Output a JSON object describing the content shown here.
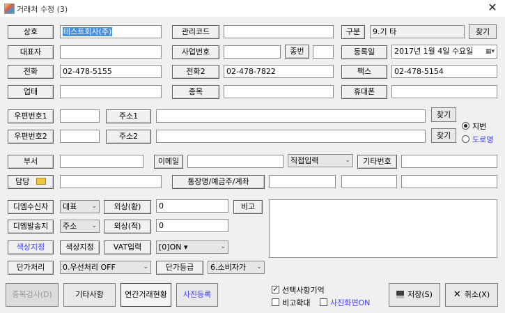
{
  "window": {
    "title": "거래처 수정 (3)",
    "close": "✕"
  },
  "fields": {
    "sangho": {
      "label": "상호",
      "value": "테스트회사(주)"
    },
    "gwanri": {
      "label": "관리코드",
      "value": ""
    },
    "gubun": {
      "label": "구분",
      "value": "9.기   타",
      "button": "찾기"
    },
    "daepyo": {
      "label": "대표자",
      "value": ""
    },
    "saup": {
      "label": "사업번호",
      "value": "",
      "jongbeon_label": "종번",
      "jongbeon_value": ""
    },
    "deungrok": {
      "label": "등록일",
      "value": "2017년  1월  4일 수요일"
    },
    "jeonhwa": {
      "label": "전화",
      "value": "02-478-5155"
    },
    "jeonhwa2": {
      "label": "전화2",
      "value": "02-478-7822"
    },
    "fax": {
      "label": "팩스",
      "value": "02-478-5154"
    },
    "uptae": {
      "label": "업태",
      "value": ""
    },
    "jongmok": {
      "label": "종목",
      "value": ""
    },
    "hyudaepon": {
      "label": "휴대폰",
      "value": ""
    },
    "upyeon1": {
      "label": "우편번호1",
      "value": ""
    },
    "juso1": {
      "label": "주소1",
      "value": "",
      "button": "찾기"
    },
    "upyeon2": {
      "label": "우편번호2",
      "value": ""
    },
    "juso2": {
      "label": "주소2",
      "value": "",
      "button": "찾기"
    },
    "buseo": {
      "label": "부서",
      "value": ""
    },
    "email": {
      "label": "이메일",
      "value": "",
      "mode": "직접입력"
    },
    "gitabeonho": {
      "label": "기타번호",
      "value": ""
    },
    "damdang": {
      "label": "담당",
      "value": ""
    },
    "tongjang": {
      "label": "통장명/예금주/계좌",
      "v1": "",
      "v2": "",
      "v3": ""
    },
    "dm_recv": {
      "label": "디엠수신자",
      "value": "대표"
    },
    "dm_send": {
      "label": "디엠발송지",
      "value": "주소"
    },
    "oesang_hwang": {
      "label": "외상(황)",
      "value": "0"
    },
    "oesang_jeok": {
      "label": "외상(적)",
      "value": "0"
    },
    "bigo": {
      "label": "비고",
      "value": ""
    },
    "color1": {
      "label": "색상지정"
    },
    "color2": {
      "label": "색상지정"
    },
    "vat": {
      "label": "VAT입력",
      "value": "[0]ON ▾"
    },
    "danga_cheori": {
      "label": "단가처리",
      "value": "0.우선처리 OFF"
    },
    "danga_deunggeup": {
      "label": "단가등급",
      "value": "6.소비자가"
    }
  },
  "address_type": {
    "jibeon": "지번",
    "doro": "도로명",
    "selected": "jibeon"
  },
  "bottom": {
    "dup_check": "중복검사(D)",
    "gita": "기타사항",
    "yeongan": "연간거래현황",
    "photo": "사진등록",
    "seontaek": "선택사항기억",
    "bigo_hwakdae": "비고확대",
    "photo_on": "사진화면ON",
    "save": "저장(S)",
    "cancel": "취소(X)"
  },
  "colors": {
    "accent_blue": "#3b3bff",
    "selection": "#4a90d9",
    "frame": "#f0f0f0"
  }
}
